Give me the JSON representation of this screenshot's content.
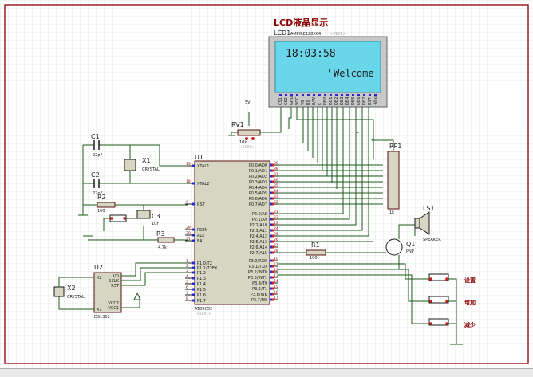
{
  "lcd": {
    "title": "LCD液晶显示",
    "ref": "LCD1",
    "model": "AMPIRE128X64",
    "text_tag": "<TEXT>",
    "screen_time": "18:03:58",
    "screen_msg": "Welcome",
    "pins": [
      "CS1",
      "CS2",
      "GND",
      "VCC",
      "V0",
      "RS",
      "R/W",
      "E",
      "DB0",
      "DB1",
      "DB2",
      "DB3",
      "DB4",
      "DB5",
      "DB6",
      "DB7",
      "RST",
      "-Vout"
    ]
  },
  "mcu": {
    "ref": "U1",
    "model": "AT89C52",
    "text_tag": "<TEXT>",
    "left_pins": [
      {
        "num": "19",
        "name": "XTAL1"
      },
      {
        "num": "18",
        "name": "XTAL2"
      },
      {
        "num": "9",
        "name": "RST"
      },
      {
        "num": "29",
        "name": "PSEN"
      },
      {
        "num": "30",
        "name": "ALE"
      },
      {
        "num": "31",
        "name": "EA"
      },
      {
        "num": "1",
        "name": "P1.0/T2"
      },
      {
        "num": "2",
        "name": "P1.1/T2EX"
      },
      {
        "num": "3",
        "name": "P1.2"
      },
      {
        "num": "4",
        "name": "P1.3"
      },
      {
        "num": "5",
        "name": "P1.4"
      },
      {
        "num": "6",
        "name": "P1.5"
      },
      {
        "num": "7",
        "name": "P1.6"
      },
      {
        "num": "8",
        "name": "P1.7"
      }
    ],
    "right_p0": [
      {
        "num": "39",
        "name": "P0.0/AD0"
      },
      {
        "num": "38",
        "name": "P0.1/AD1"
      },
      {
        "num": "37",
        "name": "P0.2/AD2"
      },
      {
        "num": "36",
        "name": "P0.3/AD3"
      },
      {
        "num": "35",
        "name": "P0.4/AD4"
      },
      {
        "num": "34",
        "name": "P0.5/AD5"
      },
      {
        "num": "33",
        "name": "P0.6/AD6"
      },
      {
        "num": "32",
        "name": "P0.7/AD7"
      }
    ],
    "right_p2": [
      {
        "num": "21",
        "name": "P2.0/A8"
      },
      {
        "num": "22",
        "name": "P2.1/A9"
      },
      {
        "num": "23",
        "name": "P2.2/A10"
      },
      {
        "num": "24",
        "name": "P2.3/A11"
      },
      {
        "num": "25",
        "name": "P2.4/A12"
      },
      {
        "num": "26",
        "name": "P2.5/A13"
      },
      {
        "num": "27",
        "name": "P2.6/A14"
      },
      {
        "num": "28",
        "name": "P2.7/A15"
      }
    ],
    "right_p3": [
      {
        "num": "10",
        "name": "P3.0/RXD"
      },
      {
        "num": "11",
        "name": "P3.1/TXD"
      },
      {
        "num": "12",
        "name": "P3.2/INT0"
      },
      {
        "num": "13",
        "name": "P3.3/INT1"
      },
      {
        "num": "14",
        "name": "P3.4/T0"
      },
      {
        "num": "15",
        "name": "P3.5/T1"
      },
      {
        "num": "16",
        "name": "P3.6/WR"
      },
      {
        "num": "17",
        "name": "P3.7/RD"
      }
    ]
  },
  "rtc": {
    "ref": "U2",
    "model": "DS1302",
    "pins_left": [
      "X2",
      "X1"
    ],
    "pins_right": [
      "I/O",
      "SCLK",
      "RST",
      "VCC2",
      "VCC1"
    ],
    "pin_nums": [
      "3",
      "2",
      "1",
      "5",
      "8",
      "1"
    ]
  },
  "parts": {
    "c1": {
      "ref": "C1",
      "value": "22pF"
    },
    "c2": {
      "ref": "C2",
      "value": "22pF"
    },
    "c3": {
      "ref": "C3",
      "value": "1uF"
    },
    "x1": {
      "ref": "X1",
      "value": "CRYSTAL"
    },
    "x2": {
      "ref": "X2",
      "value": "CRYSTAL"
    },
    "r1": {
      "ref": "R1",
      "value": "100"
    },
    "r2": {
      "ref": "R2",
      "value": "100"
    },
    "r3": {
      "ref": "R3",
      "value": "4.7k"
    },
    "rv1": {
      "ref": "RV1",
      "value": "10k"
    },
    "rp1": {
      "ref": "RP1",
      "value": "1k"
    },
    "q1": {
      "ref": "Q1",
      "value": "PNP"
    },
    "ls1": {
      "ref": "LS1",
      "value": "SPEAKER"
    },
    "vcc_label": "5V",
    "text_tag": "<TEXT>"
  },
  "buttons": {
    "set": "设置",
    "up": "增加",
    "down": "减少"
  },
  "status": {
    "text": ""
  }
}
